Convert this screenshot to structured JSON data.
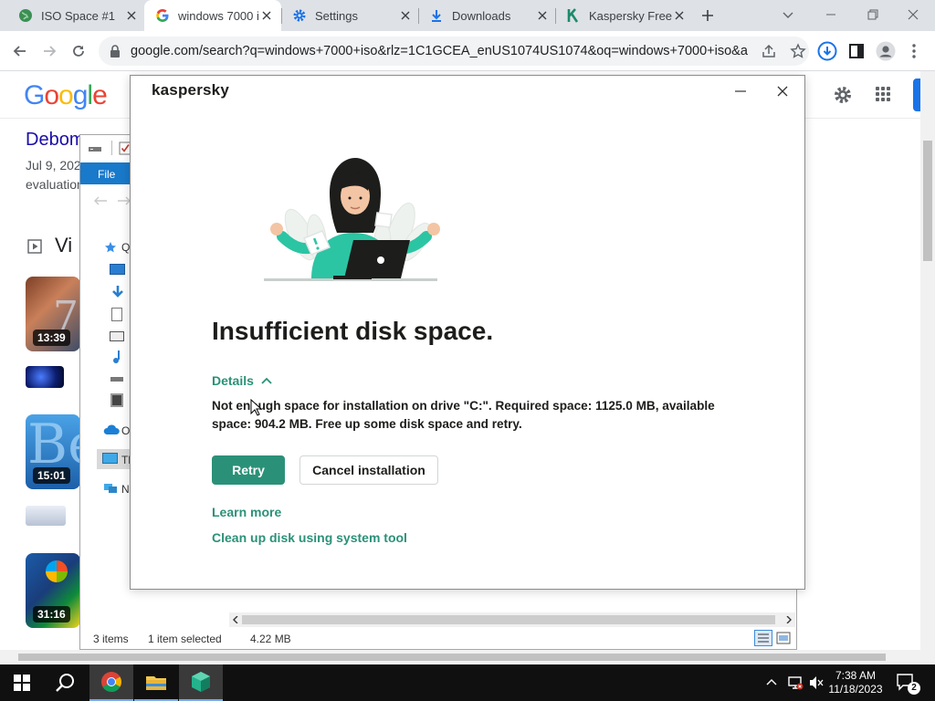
{
  "browser": {
    "tabs": [
      {
        "label": "ISO Space #1",
        "icon": "globe-icon",
        "active": false
      },
      {
        "label": "windows 7000 i",
        "icon": "google-g-icon",
        "active": true
      },
      {
        "label": "Settings",
        "icon": "gear-icon",
        "active": false
      },
      {
        "label": "Downloads",
        "icon": "download-icon",
        "active": false
      },
      {
        "label": "Kaspersky Free",
        "icon": "kaspersky-k-icon",
        "active": false
      }
    ],
    "url": "google.com/search?q=windows+7000+iso&rlz=1C1GCEA_enUS1074US1074&oq=windows+7000+iso&aq..."
  },
  "google": {
    "logo": "Google",
    "result_title": "Debom",
    "result_date": "Jul 9, 202",
    "result_snippet": "evaluation",
    "videos_header": "Vi",
    "video_durations": [
      "13:39",
      "15:01",
      "31:16"
    ]
  },
  "explorer": {
    "file_tab": "File",
    "nav_items": [
      "Q",
      "O",
      "Th",
      "N"
    ],
    "status_items": "3 items",
    "status_selected": "1 item selected",
    "status_size": "4.22 MB"
  },
  "dialog": {
    "brand": "kaspersky",
    "title": "Insufficient disk space.",
    "details_label": "Details",
    "message_line1": "Not enough space for installation on drive \"C:\". Required space: 1125.0 MB, available",
    "message_line2": "space: 904.2 MB. Free up some disk space and retry.",
    "retry_label": "Retry",
    "cancel_label": "Cancel installation",
    "learn_more": "Learn more",
    "cleanup": "Clean up disk using system tool",
    "accent_color": "#2a9178"
  },
  "taskbar": {
    "time": "7:38 AM",
    "date": "11/18/2023",
    "notification_count": "2"
  }
}
